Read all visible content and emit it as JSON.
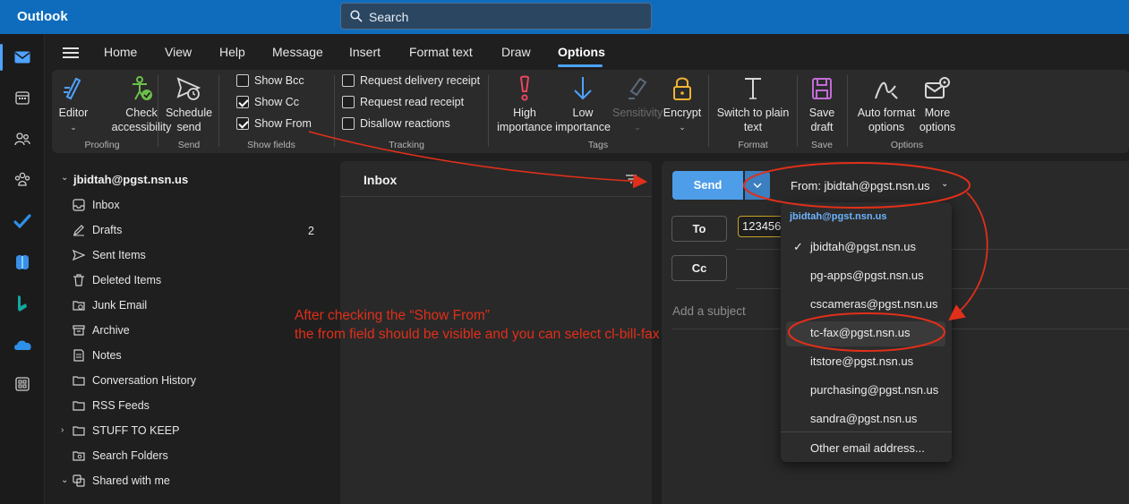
{
  "app": {
    "title": "Outlook"
  },
  "search": {
    "placeholder": "Search"
  },
  "rail": {
    "items": [
      {
        "name": "mail-icon",
        "active": true
      },
      {
        "name": "calendar-icon"
      },
      {
        "name": "people-icon"
      },
      {
        "name": "groups-icon"
      },
      {
        "name": "todo-icon"
      },
      {
        "name": "office-icon"
      },
      {
        "name": "bookings-icon"
      },
      {
        "name": "onedrive-icon"
      },
      {
        "name": "more-apps-icon"
      }
    ]
  },
  "menu": {
    "tabs": [
      "Home",
      "View",
      "Help",
      "Message",
      "Insert",
      "Format text",
      "Draw",
      "Options"
    ],
    "active_tab": "Options"
  },
  "ribbon": {
    "editor_label": "Editor",
    "check_access_l1": "Check",
    "check_access_l2": "accessibility",
    "proofing_label": "Proofing",
    "schedule_l1": "Schedule",
    "schedule_l2": "send",
    "send_group_label": "Send",
    "show_bcc": "Show Bcc",
    "show_cc": "Show Cc",
    "show_from": "Show From",
    "show_fields_label": "Show fields",
    "req_delivery": "Request delivery receipt",
    "req_read": "Request read receipt",
    "disallow_reactions": "Disallow reactions",
    "tracking_label": "Tracking",
    "high_l1": "High",
    "high_l2": "importance",
    "low_l1": "Low",
    "low_l2": "importance",
    "sensitivity": "Sensitivity",
    "encrypt": "Encrypt",
    "tags_label": "Tags",
    "plain_l1": "Switch to plain",
    "plain_l2": "text",
    "format_label": "Format",
    "save_l1": "Save",
    "save_l2": "draft",
    "save_group_label": "Save",
    "autoformat_l1": "Auto format",
    "autoformat_l2": "options",
    "more_l1": "More",
    "more_l2": "options",
    "options_label": "Options"
  },
  "folders": {
    "account": "jbidtah@pgst.nsn.us",
    "items": [
      {
        "label": "Inbox",
        "icon": "inbox-icon"
      },
      {
        "label": "Drafts",
        "icon": "drafts-icon",
        "count": "2"
      },
      {
        "label": "Sent Items",
        "icon": "sent-icon"
      },
      {
        "label": "Deleted Items",
        "icon": "trash-icon"
      },
      {
        "label": "Junk Email",
        "icon": "junk-icon"
      },
      {
        "label": "Archive",
        "icon": "archive-icon"
      },
      {
        "label": "Notes",
        "icon": "notes-icon"
      },
      {
        "label": "Conversation History",
        "icon": "folder-icon"
      },
      {
        "label": "RSS Feeds",
        "icon": "folder-icon"
      },
      {
        "label": "STUFF TO KEEP",
        "icon": "folder-icon"
      },
      {
        "label": "Search Folders",
        "icon": "search-folder-icon"
      },
      {
        "label": "Shared with me",
        "icon": "shared-icon"
      }
    ]
  },
  "msglist": {
    "title": "Inbox"
  },
  "compose": {
    "send_label": "Send",
    "from_label": "From: jbidtah@pgst.nsn.us",
    "to_label": "To",
    "cc_label": "Cc",
    "recipient": "123456",
    "subject_placeholder": "Add a subject"
  },
  "from_menu": {
    "header": "jbidtah@pgst.nsn.us",
    "items": [
      {
        "label": "jbidtah@pgst.nsn.us",
        "checked": true
      },
      {
        "label": "pg-apps@pgst.nsn.us"
      },
      {
        "label": "cscameras@pgst.nsn.us"
      },
      {
        "label": "tc-fax@pgst.nsn.us",
        "highlighted": true
      },
      {
        "label": "itstore@pgst.nsn.us"
      },
      {
        "label": "purchasing@pgst.nsn.us"
      },
      {
        "label": "sandra@pgst.nsn.us"
      }
    ],
    "other": "Other email address..."
  },
  "annotation": {
    "line1": "After checking the “Show From”",
    "line2": "the from field should be visible and you can select cl-bill-fax",
    "color": "#e02f1a"
  },
  "colors": {
    "accent": "#0f6cbd",
    "send": "#4d9de8",
    "link": "#4da3ff"
  }
}
